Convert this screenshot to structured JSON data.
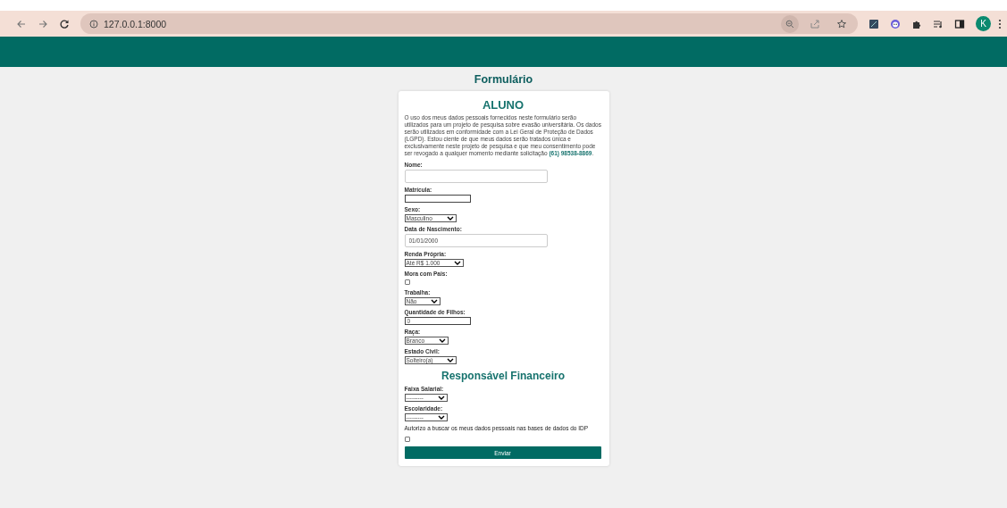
{
  "browser": {
    "url": "127.0.0.1:8000",
    "profile_initial": "K"
  },
  "page": {
    "title": "Formulário"
  },
  "form": {
    "heading": "ALUNO",
    "notice": "O uso dos meus dados pessoais fornecidos neste formulário serão utilizados para um projeto de pesquisa sobre evasão universitária. Os dados serão utilizados em conformidade com a Lei Geral de Proteção de Dados (LGPD). Estou ciente de que meus dados serão tratados única e exclusivamente neste projeto de pesquisa e que meu consentimento pode ser revogado a qualquer momento mediante solicitação **(61) 98538-8869**.",
    "fields": [
      {
        "kind": "text",
        "label": "Nome:"
      },
      {
        "kind": "shorttext",
        "label": "Matrícula:"
      },
      {
        "kind": "select",
        "label": "Sexo:",
        "value": "Masculino"
      },
      {
        "kind": "text",
        "label": "Data de Nascimento:",
        "value": "01/01/2000"
      },
      {
        "kind": "select",
        "label": "Renda Própria:",
        "value": "Até R$ 1.000"
      },
      {
        "kind": "checkbox",
        "label": "Mora com Pais:",
        "checked": false
      },
      {
        "kind": "select",
        "label": "Trabalha:",
        "value": "Não"
      },
      {
        "kind": "shorttext",
        "label": "Quantidade de Filhos:",
        "value": "0"
      },
      {
        "kind": "select",
        "label": "Raça:",
        "value": "Branco"
      },
      {
        "kind": "select",
        "label": "Estado Civil:",
        "value": "Solteiro(a)"
      },
      {
        "kind": "heading",
        "label": "Responsável Financeiro"
      },
      {
        "kind": "select",
        "label": "Faixa Salarial:",
        "value": "---------"
      },
      {
        "kind": "select",
        "label": "Escolaridade:",
        "value": "---------"
      },
      {
        "kind": "checkbox",
        "label": "Autorizo a buscar os meus dados pessoais nas bases de dados do IDP",
        "checked": false
      }
    ],
    "submit": "Enviar"
  }
}
